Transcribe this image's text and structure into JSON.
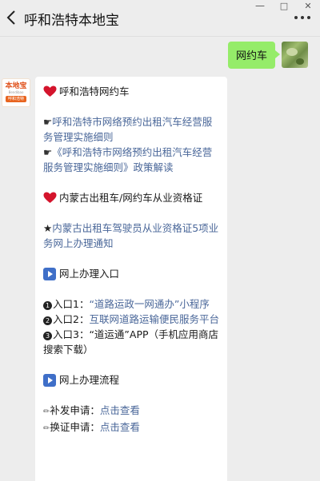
{
  "titlebar": {
    "title": "呼和浩特本地宝",
    "minimize_glyph": "—",
    "maximize_glyph": "□",
    "close_glyph": "✕"
  },
  "outgoing": {
    "text": "网约车"
  },
  "account_avatar": {
    "logo_text": "本地宝",
    "logo_sub": "Bendibao",
    "logo_bar": "呼和浩特"
  },
  "reply": {
    "section1": {
      "title": "呼和浩特网约车",
      "items": [
        {
          "glyph": "☛",
          "text": "呼和浩特市网络预约出租汽车经营服务管理实施细则"
        },
        {
          "glyph": "☛",
          "text": "《呼和浩特市网络预约出租汽车经营服务管理实施细则》政策解读"
        }
      ]
    },
    "section2": {
      "title": "内蒙古出租车/网约车从业资格证",
      "items": [
        {
          "glyph": "★",
          "text": "内蒙古出租车驾驶员从业资格证5项业务网上办理通知"
        }
      ]
    },
    "section3": {
      "title": "网上办理入口",
      "entries": [
        {
          "num": "1",
          "label": "入口1：",
          "link": "“道路运政一网通办”小程序"
        },
        {
          "num": "2",
          "label": "入口2：",
          "link": "互联网道路运输便民服务平台"
        },
        {
          "num": "3",
          "label": "入口3：",
          "text": "“道运通”APP（手机应用商店搜索下载）"
        }
      ]
    },
    "section4": {
      "title": "网上办理流程",
      "items": [
        {
          "glyph": "✏",
          "label": "补发申请：",
          "link": "点击查看"
        },
        {
          "glyph": "✏",
          "label": "换证申请：",
          "link": "点击查看"
        }
      ]
    }
  },
  "colors": {
    "link": "#4a6799",
    "bubble_out": "#95ec69",
    "heart": "#d4142c"
  }
}
